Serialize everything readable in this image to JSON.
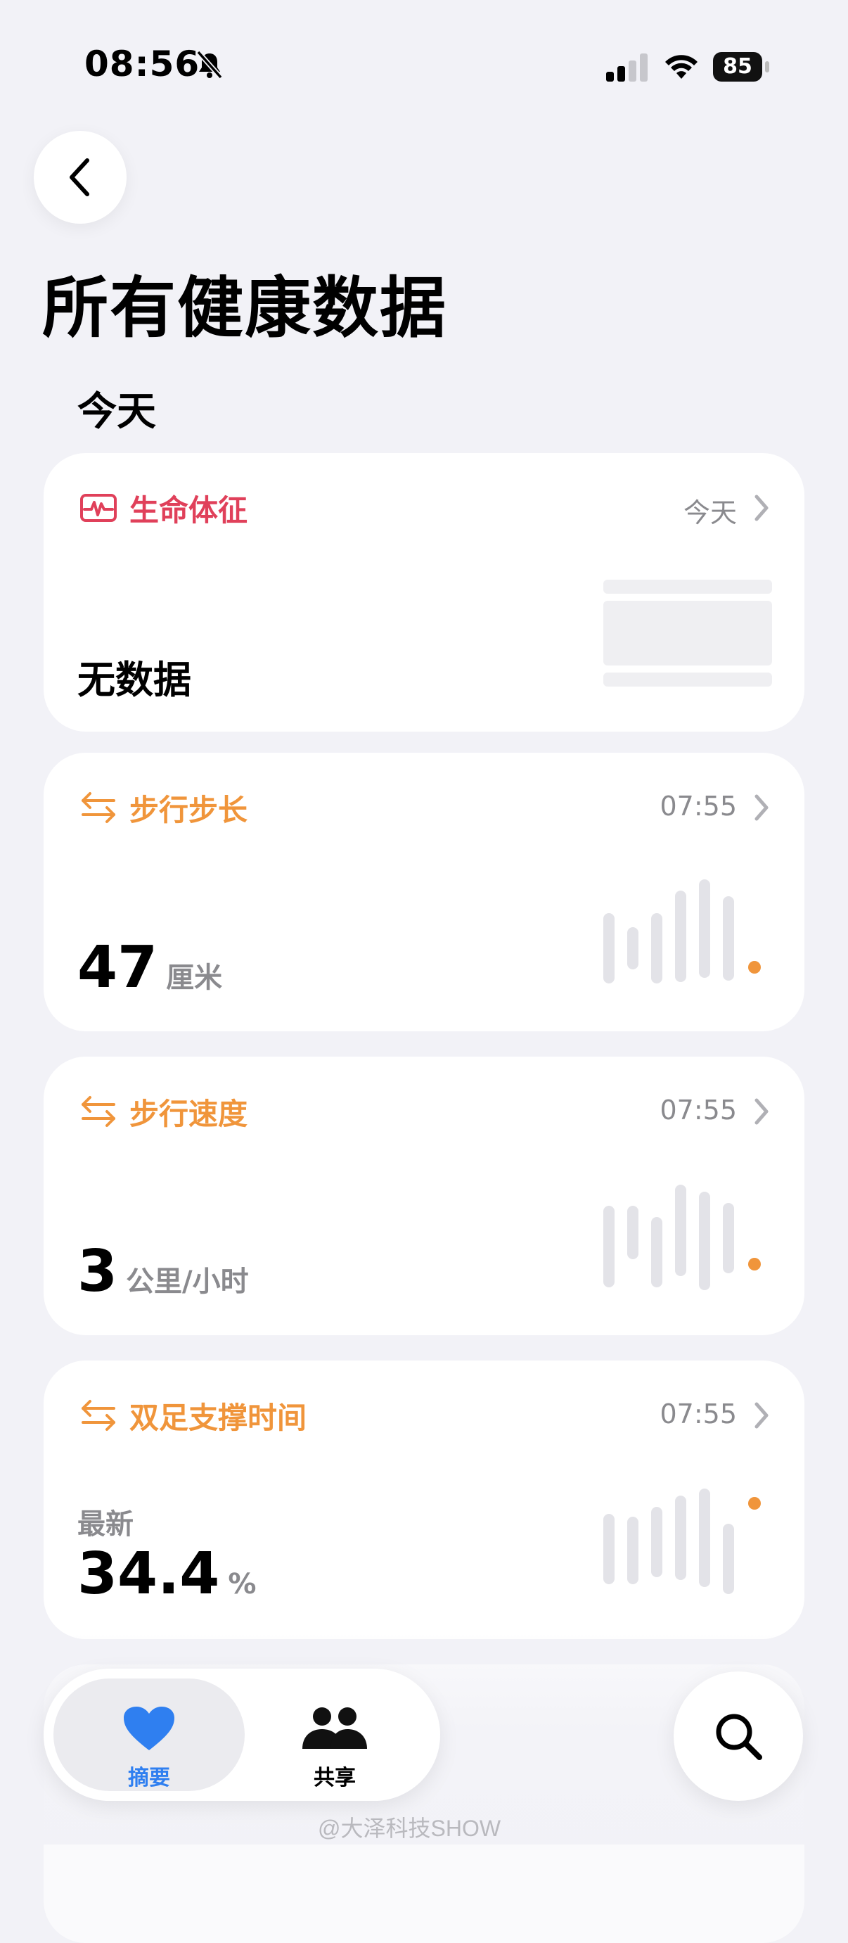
{
  "status_bar": {
    "time": "08:56",
    "battery": "85"
  },
  "page": {
    "title": "所有健康数据",
    "section": "今天"
  },
  "cards": [
    {
      "title": "生命体征",
      "time": "今天",
      "no_data": "无数据",
      "color": "#e0405a",
      "icon": "vitals-icon"
    },
    {
      "title": "步行步长",
      "time": "07:55",
      "value": "47",
      "unit": "厘米",
      "color": "#f0953b",
      "icon": "mobility-arrows-icon"
    },
    {
      "title": "步行速度",
      "time": "07:55",
      "value": "3",
      "unit": "公里/小时",
      "color": "#f0953b",
      "icon": "mobility-arrows-icon"
    },
    {
      "title": "双足支撑时间",
      "time": "07:55",
      "label": "最新",
      "value": "34.4",
      "unit": "%",
      "color": "#f0953b",
      "icon": "mobility-arrows-icon"
    }
  ],
  "tabbar": {
    "summary": "摘要",
    "sharing": "共享",
    "accent": "#2f7ff0"
  },
  "watermark": "@大泽科技SHOW"
}
